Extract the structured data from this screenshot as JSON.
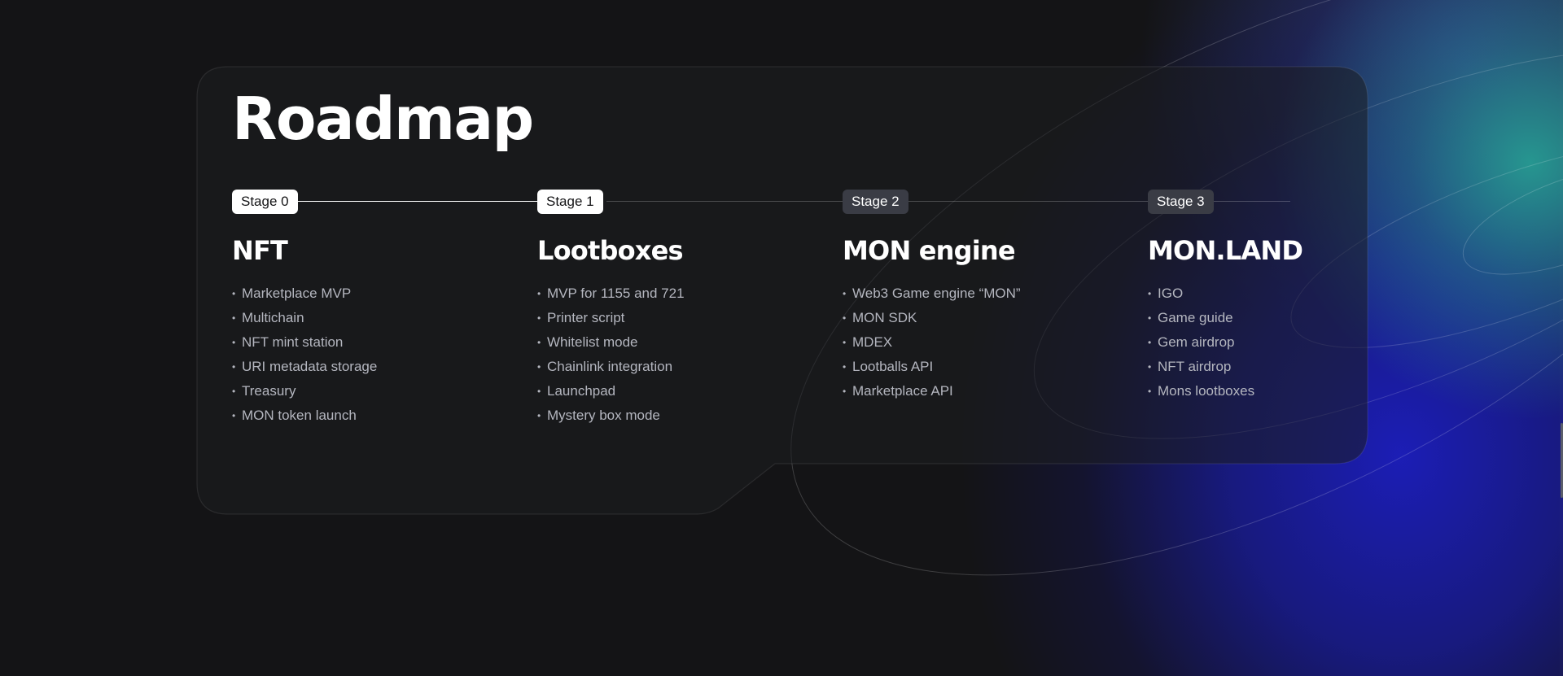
{
  "section": {
    "title": "Roadmap"
  },
  "stages": [
    {
      "badge": "Stage 0",
      "status": "active",
      "title": "NFT",
      "items": [
        "Marketplace MVP",
        "Multichain",
        "NFT mint station",
        "URI metadata storage",
        "Treasury",
        "MON token launch"
      ]
    },
    {
      "badge": "Stage 1",
      "status": "active",
      "title": "Lootboxes",
      "items": [
        "MVP for 1155 and 721",
        "Printer script",
        "Whitelist mode",
        "Chainlink integration",
        "Launchpad",
        "Mystery box mode"
      ]
    },
    {
      "badge": "Stage 2",
      "status": "inactive",
      "title": "MON engine",
      "items": [
        "Web3 Game engine “MON”",
        "MON SDK",
        "MDEX",
        "Lootballs API",
        "Marketplace API"
      ]
    },
    {
      "badge": "Stage 3",
      "status": "inactive",
      "title": "MON.LAND",
      "items": [
        "IGO",
        "Game guide",
        "Gem airdrop",
        "NFT airdrop",
        "Mons lootboxes"
      ]
    }
  ],
  "colors": {
    "background": "#141416",
    "active_badge": "#ffffff",
    "inactive_badge": "#3a3c45",
    "item_text": "#b4b6bf",
    "glow_blue": "#1c1ebe",
    "glow_teal": "#28aa96"
  }
}
